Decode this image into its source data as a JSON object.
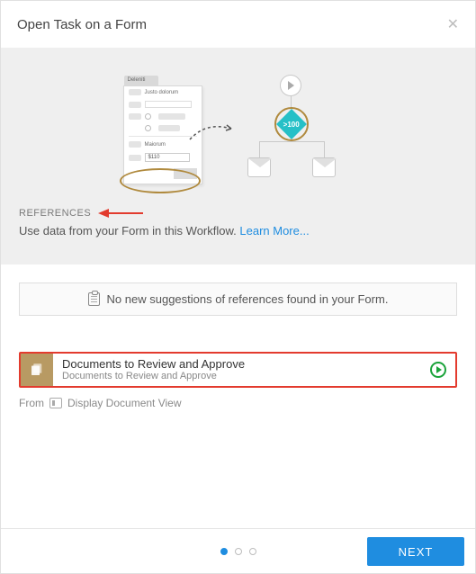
{
  "header": {
    "title": "Open Task on a Form"
  },
  "illustration": {
    "form_tab": "Deleniti",
    "row1": "Justo dolorum",
    "row2": "Maiorum",
    "price": "$110",
    "diamond": ">100"
  },
  "references": {
    "title": "REFERENCES",
    "desc": "Use data from your Form in this Workflow.  ",
    "learn_more": "Learn More..."
  },
  "info_bar": {
    "text": "No new suggestions of references found in your Form."
  },
  "doc_card": {
    "title": "Documents to Review and Approve",
    "sub": "Documents to Review and Approve"
  },
  "from_row": {
    "from": "From",
    "view": "Display Document View"
  },
  "footer": {
    "next": "NEXT"
  }
}
